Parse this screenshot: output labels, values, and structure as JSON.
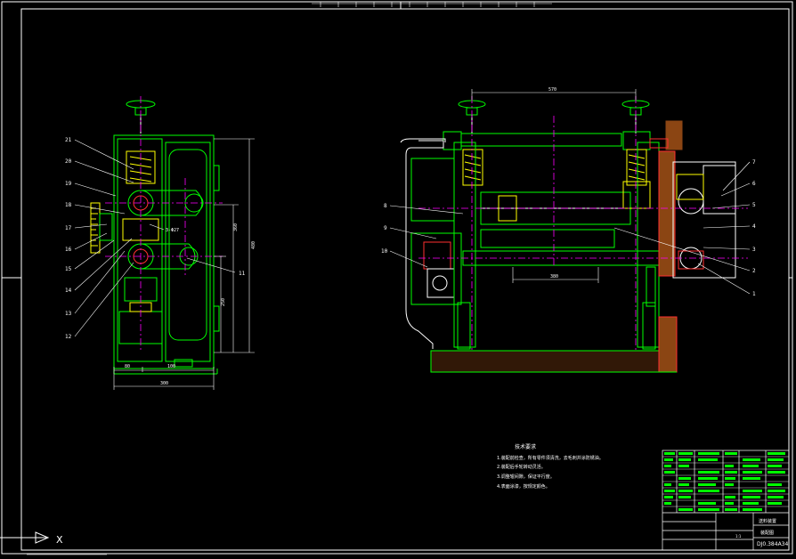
{
  "colors": {
    "background": "#000000",
    "border": "#ffffff",
    "outline": "#00ff00",
    "center": "#ff00ff",
    "dimension": "#ffffff",
    "yellow": "#ffff00",
    "brown": "#8b4513",
    "red": "#ff3030",
    "cyan": "#00ffff",
    "label": "#00ff00"
  },
  "side_view": {
    "part_numbers": [
      "21",
      "20",
      "19",
      "18",
      "17",
      "16",
      "15",
      "14",
      "13",
      "12",
      "11"
    ],
    "dims": {
      "width_a": "80",
      "width_b": "100",
      "width_total": "300",
      "height_total": "480",
      "height_mid": "360",
      "height_low": "250",
      "tag": "3-Φ27"
    }
  },
  "front_view": {
    "part_numbers_left": [
      "8",
      "9",
      "10"
    ],
    "part_numbers_right": [
      "7",
      "6",
      "5",
      "4",
      "3",
      "2",
      "1"
    ],
    "dims": {
      "top": "570",
      "bottom": "380"
    }
  },
  "tech_requirements": {
    "title": "技术要求",
    "lines": [
      "1.装配前检查，所有零件须清洗，去毛刺并涂防锈油。",
      "2.装配后手轮转动灵活。",
      "3.调整辊间隙，保证平行度。",
      "4.表面涂漆，按规定颜色。"
    ]
  },
  "title_block": {
    "name_line1": "送料装置",
    "name_line2": "装配图",
    "code": "DJ0.384A34",
    "scale_row": "1:1"
  },
  "ucs": {
    "x_label": "X"
  }
}
